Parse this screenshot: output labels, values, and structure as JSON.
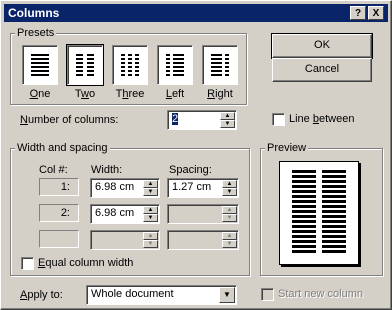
{
  "window": {
    "title": "Columns",
    "help_btn": "?",
    "close_btn": "X"
  },
  "presets": {
    "group_label": "Presets",
    "items": [
      {
        "label": "One",
        "mnemonic": "O",
        "rest": "ne"
      },
      {
        "label": "Two",
        "mnemonic": "w",
        "pre": "T",
        "rest": "o"
      },
      {
        "label": "Three",
        "mnemonic": "h",
        "pre": "T",
        "rest": "ree"
      },
      {
        "label": "Left",
        "mnemonic": "L",
        "rest": "eft"
      },
      {
        "label": "Right",
        "mnemonic": "R",
        "rest": "ight"
      }
    ],
    "selected": "Two"
  },
  "buttons": {
    "ok": "OK",
    "cancel": "Cancel"
  },
  "num_columns": {
    "label_pre": "",
    "label_mn": "N",
    "label_rest": "umber of columns:",
    "value": "2"
  },
  "line_between": {
    "pre": "Line ",
    "mn": "b",
    "rest": "etween",
    "checked": false
  },
  "width_spacing": {
    "group_label": "Width and spacing",
    "col_header": "Col #:",
    "width_header": "Width:",
    "spacing_header": "Spacing:",
    "rows": [
      {
        "col": "1:",
        "width": "6.98 cm",
        "spacing": "1.27 cm"
      },
      {
        "col": "2:",
        "width": "6.98 cm",
        "spacing": ""
      },
      {
        "col": "",
        "width": "",
        "spacing": ""
      }
    ],
    "equal_width": {
      "pre": "",
      "mn": "E",
      "rest": "qual column width",
      "checked": false
    }
  },
  "preview": {
    "group_label": "Preview"
  },
  "apply_to": {
    "label_pre": "",
    "label_mn": "A",
    "label_rest": "pply to:",
    "value": "Whole document"
  },
  "start_new_column": {
    "label": "Start new column",
    "checked": false,
    "enabled": false
  }
}
